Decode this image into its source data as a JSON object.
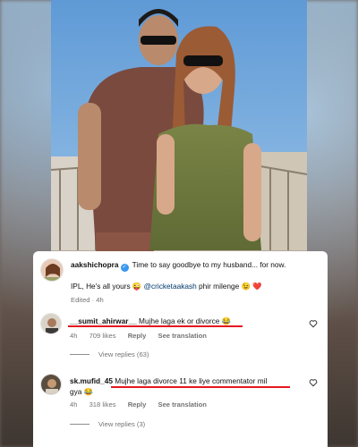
{
  "post": {
    "author": "aakshichopra",
    "caption_line1": "Time to say goodbye to my husband... for now.",
    "caption_line2_prefix": "IPL, He's all yours",
    "caption_mention": "@cricketaakash",
    "caption_line2_suffix": "phir milenge",
    "edited": "Edited · 4h",
    "emoji_wink": "😜",
    "emoji_smile": "😉",
    "emoji_heart": "❤️"
  },
  "comments": [
    {
      "username": "__sumit_ahirwar__",
      "text": "Mujhe laga ek or divorce",
      "emoji": "😂",
      "time": "4h",
      "likes": "709 likes",
      "reply": "Reply",
      "translate": "See translation",
      "view_replies": "View replies (63)"
    },
    {
      "username": "sk.mufid_45",
      "text": "Mujhe laga divorce 11 ke liye commentator mil",
      "text_cont": "gya",
      "emoji": "😂",
      "time": "4h",
      "likes": "318 likes",
      "reply": "Reply",
      "translate": "See translation",
      "view_replies": "View replies (3)"
    }
  ],
  "colors": {
    "highlight_underline": "#e5171f",
    "verified_badge": "#3897f0",
    "mention": "#00376b",
    "meta": "#737373"
  },
  "icons": {
    "verified": "verified-badge-icon",
    "like": "heart-outline-icon"
  }
}
